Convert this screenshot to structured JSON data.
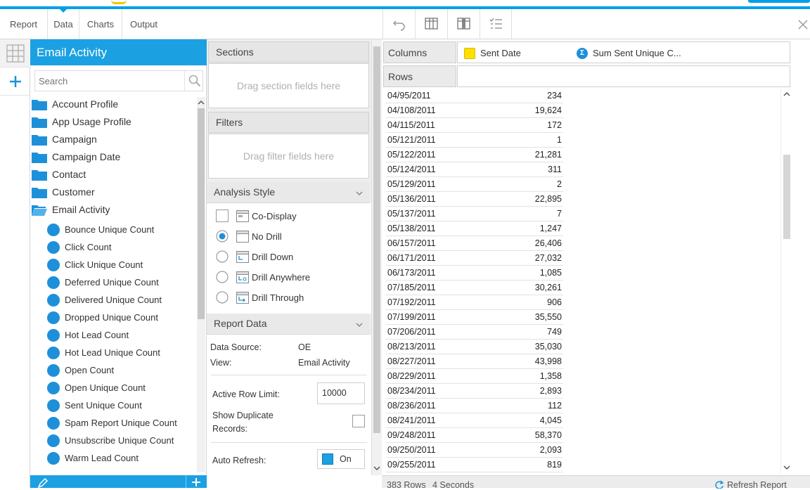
{
  "menu": {
    "tabs": [
      "Report",
      "Data",
      "Charts",
      "Output"
    ],
    "active": "Data"
  },
  "fields_panel": {
    "title": "Email Activity",
    "search_placeholder": "Search",
    "folders": [
      "Account Profile",
      "App Usage Profile",
      "Campaign",
      "Campaign Date",
      "Contact",
      "Customer",
      "Email Activity"
    ],
    "fields": [
      "Bounce Unique Count",
      "Click Count",
      "Click Unique Count",
      "Deferred Unique Count",
      "Delivered Unique Count",
      "Dropped Unique Count",
      "Hot Lead Count",
      "Hot Lead Unique Count",
      "Open Count",
      "Open Unique Count",
      "Sent Unique Count",
      "Spam Report Unique Count",
      "Unsubscribe Unique Count",
      "Warm Lead Count"
    ]
  },
  "sections": {
    "title": "Sections",
    "drop_hint": "Drag section fields here"
  },
  "filters": {
    "title": "Filters",
    "drop_hint": "Drag filter fields here"
  },
  "analysis_style": {
    "title": "Analysis Style",
    "options": [
      "Co-Display",
      "No Drill",
      "Drill Down",
      "Drill Anywhere",
      "Drill Through"
    ],
    "selected": "No Drill"
  },
  "report_data": {
    "title": "Report Data",
    "data_source_label": "Data Source:",
    "data_source_value": "OE",
    "view_label": "View:",
    "view_value": "Email Activity",
    "row_limit_label": "Active Row Limit:",
    "row_limit_value": "10000",
    "show_duplicate_label_1": "Show Duplicate",
    "show_duplicate_label_2": "Records:",
    "auto_refresh_label": "Auto Refresh:",
    "auto_refresh_value": "On"
  },
  "columns": {
    "label": "Columns",
    "fields": [
      "Sent Date",
      "Sum Sent Unique C..."
    ]
  },
  "rows": {
    "label": "Rows"
  },
  "table": [
    [
      "04/95/2011",
      "234"
    ],
    [
      "04/108/2011",
      "19,624"
    ],
    [
      "04/115/2011",
      "172"
    ],
    [
      "05/121/2011",
      "1"
    ],
    [
      "05/122/2011",
      "21,281"
    ],
    [
      "05/124/2011",
      "311"
    ],
    [
      "05/129/2011",
      "2"
    ],
    [
      "05/136/2011",
      "22,895"
    ],
    [
      "05/137/2011",
      "7"
    ],
    [
      "05/138/2011",
      "1,247"
    ],
    [
      "06/157/2011",
      "26,406"
    ],
    [
      "06/171/2011",
      "27,032"
    ],
    [
      "06/173/2011",
      "1,085"
    ],
    [
      "07/185/2011",
      "30,261"
    ],
    [
      "07/192/2011",
      "906"
    ],
    [
      "07/199/2011",
      "35,550"
    ],
    [
      "07/206/2011",
      "749"
    ],
    [
      "08/213/2011",
      "35,030"
    ],
    [
      "08/227/2011",
      "43,998"
    ],
    [
      "08/229/2011",
      "1,358"
    ],
    [
      "08/234/2011",
      "2,893"
    ],
    [
      "08/236/2011",
      "112"
    ],
    [
      "08/241/2011",
      "4,045"
    ],
    [
      "09/248/2011",
      "58,370"
    ],
    [
      "09/250/2011",
      "2,093"
    ],
    [
      "09/255/2011",
      "819"
    ]
  ],
  "status": {
    "rows": "383 Rows",
    "time": "4 Seconds",
    "refresh_label": "Refresh Report"
  }
}
